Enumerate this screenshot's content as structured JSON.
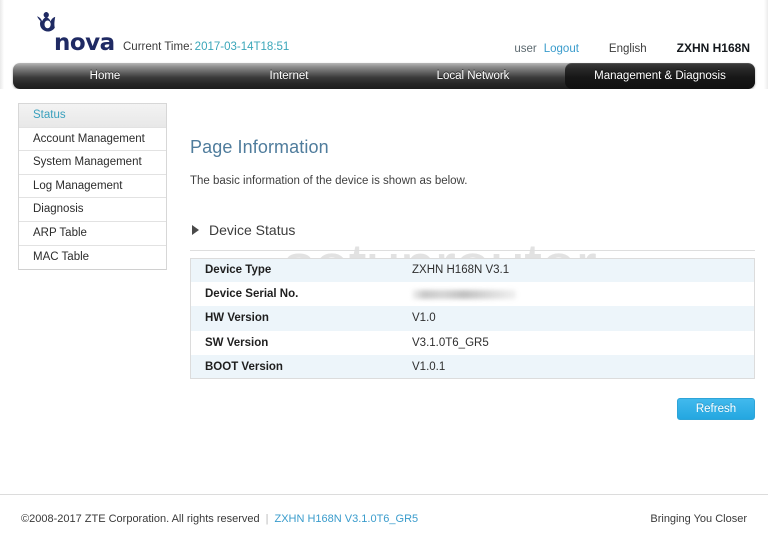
{
  "header": {
    "logo_text": "nova",
    "logo_icon": "nova-crown-icon",
    "current_time_label": "Current Time:",
    "current_time_value": "2017-03-14T18:51",
    "user_label": "user",
    "logout_label": "Logout",
    "language_label": "English",
    "model_label": "ZXHN H168N"
  },
  "nav": {
    "tabs": [
      {
        "label": "Home",
        "active": false
      },
      {
        "label": "Internet",
        "active": false
      },
      {
        "label": "Local Network",
        "active": false
      },
      {
        "label": "Management & Diagnosis",
        "active": true
      }
    ]
  },
  "sidebar": {
    "items": [
      {
        "label": "Status",
        "active": true
      },
      {
        "label": "Account Management",
        "active": false
      },
      {
        "label": "System Management",
        "active": false
      },
      {
        "label": "Log Management",
        "active": false
      },
      {
        "label": "Diagnosis",
        "active": false
      },
      {
        "label": "ARP Table",
        "active": false
      },
      {
        "label": "MAC Table",
        "active": false
      }
    ]
  },
  "watermark": {
    "text": "setuprouter"
  },
  "main": {
    "page_title": "Page Information",
    "page_subtitle": "The basic information of the device is shown as below.",
    "section_title": "Device Status",
    "section_toggle_icon": "triangle-right-icon",
    "table": {
      "rows": [
        {
          "label": "Device Type",
          "value": "ZXHN H168N V3.1",
          "redacted": false
        },
        {
          "label": "Device Serial No.",
          "value": "",
          "redacted": true
        },
        {
          "label": "HW Version",
          "value": "V1.0",
          "redacted": false
        },
        {
          "label": "SW Version",
          "value": "V3.1.0T6_GR5",
          "redacted": false
        },
        {
          "label": "BOOT Version",
          "value": "V1.0.1",
          "redacted": false
        }
      ]
    },
    "refresh_label": "Refresh"
  },
  "footer": {
    "copyright": "©2008-2017 ZTE Corporation. All rights reserved",
    "separator": "|",
    "firmware_link": "ZXHN H168N V3.1.0T6_GR5",
    "tagline": "Bringing You Closer"
  },
  "colors": {
    "accent_teal": "#3aa6b9",
    "link_blue": "#3a9ccc",
    "title_blue": "#4f7c9c",
    "button_blue": "#24a7e0",
    "logo_navy": "#1f2a63",
    "table_row_alt": "#edf5fa"
  }
}
